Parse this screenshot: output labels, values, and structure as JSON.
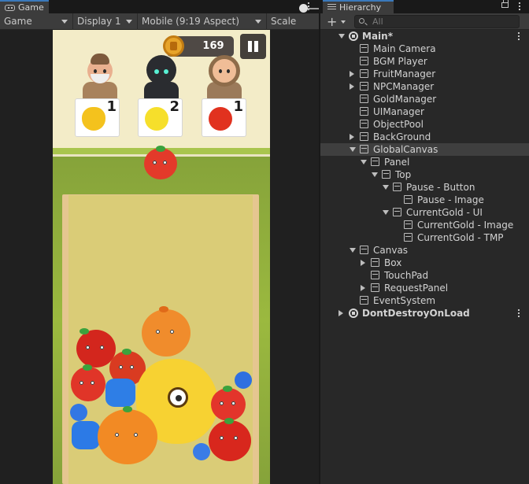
{
  "game_window": {
    "tab_title": "Game",
    "toolbar": {
      "mode": "Game",
      "display": "Display 1",
      "aspect": "Mobile (9:19 Aspect)",
      "scale_label": "Scale"
    }
  },
  "game_view": {
    "gold_value": "169",
    "requests": [
      {
        "fruit": "yellow-pepper",
        "count": "1"
      },
      {
        "fruit": "lemon",
        "count": "2"
      },
      {
        "fruit": "tomato",
        "count": "1"
      }
    ],
    "colors": {
      "sky": "#f3ecc8",
      "grass": "#a9c54e",
      "field": "#86a33a",
      "box": "#dacc77"
    }
  },
  "hierarchy": {
    "tab_title": "Hierarchy",
    "add_label": "+",
    "search_placeholder": "All",
    "rows": [
      {
        "label": "Main*",
        "depth": 0,
        "icon": "unity-scene-icon",
        "arrow": "down"
      },
      {
        "label": "Main Camera",
        "depth": 1,
        "icon": "gameobject-icon",
        "arrow": ""
      },
      {
        "label": "BGM Player",
        "depth": 1,
        "icon": "gameobject-icon",
        "arrow": ""
      },
      {
        "label": "FruitManager",
        "depth": 1,
        "icon": "gameobject-icon",
        "arrow": "right"
      },
      {
        "label": "NPCManager",
        "depth": 1,
        "icon": "gameobject-icon",
        "arrow": "right"
      },
      {
        "label": "GoldManager",
        "depth": 1,
        "icon": "gameobject-icon",
        "arrow": ""
      },
      {
        "label": "UIManager",
        "depth": 1,
        "icon": "gameobject-icon",
        "arrow": ""
      },
      {
        "label": "ObjectPool",
        "depth": 1,
        "icon": "gameobject-icon",
        "arrow": ""
      },
      {
        "label": "BackGround",
        "depth": 1,
        "icon": "gameobject-icon",
        "arrow": "right"
      },
      {
        "label": "GlobalCanvas",
        "depth": 1,
        "icon": "gameobject-icon",
        "arrow": "down",
        "selected": true
      },
      {
        "label": "Panel",
        "depth": 2,
        "icon": "gameobject-icon",
        "arrow": "down"
      },
      {
        "label": "Top",
        "depth": 3,
        "icon": "gameobject-icon",
        "arrow": "down"
      },
      {
        "label": "Pause - Button",
        "depth": 4,
        "icon": "gameobject-icon",
        "arrow": "down"
      },
      {
        "label": "Pause - Image",
        "depth": 5,
        "icon": "gameobject-icon",
        "arrow": ""
      },
      {
        "label": "CurrentGold - UI",
        "depth": 4,
        "icon": "gameobject-icon",
        "arrow": "down"
      },
      {
        "label": "CurrentGold - Image",
        "depth": 5,
        "icon": "gameobject-icon",
        "arrow": ""
      },
      {
        "label": "CurrentGold - TMP",
        "depth": 5,
        "icon": "gameobject-icon",
        "arrow": ""
      },
      {
        "label": "Canvas",
        "depth": 1,
        "icon": "gameobject-icon",
        "arrow": "down"
      },
      {
        "label": "Box",
        "depth": 2,
        "icon": "gameobject-icon",
        "arrow": "right"
      },
      {
        "label": "TouchPad",
        "depth": 2,
        "icon": "gameobject-icon",
        "arrow": ""
      },
      {
        "label": "RequestPanel",
        "depth": 2,
        "icon": "gameobject-icon",
        "arrow": "right"
      },
      {
        "label": "EventSystem",
        "depth": 1,
        "icon": "gameobject-icon",
        "arrow": ""
      },
      {
        "label": "DontDestroyOnLoad",
        "depth": 0,
        "icon": "unity-scene-icon",
        "arrow": "right"
      }
    ]
  }
}
